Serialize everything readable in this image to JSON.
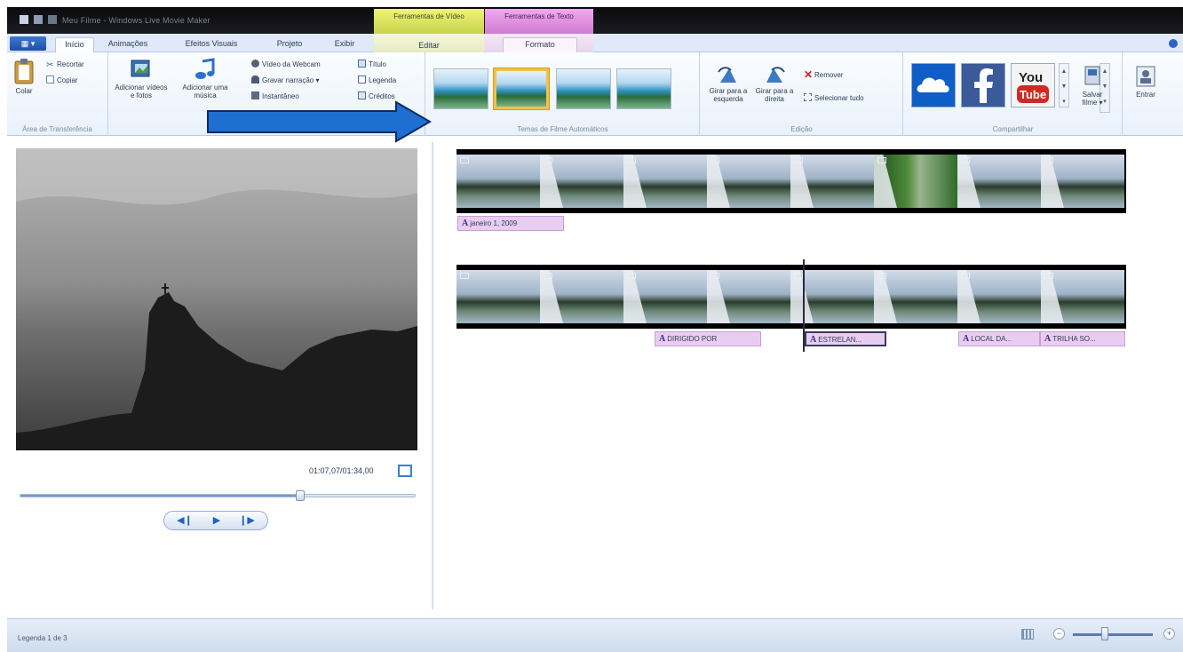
{
  "title_bar": {
    "app_title": "Meu Filme - Windows Live Movie Maker",
    "contextual_groups": [
      {
        "label": "Ferramentas de Vídeo",
        "tab": "Editar",
        "color": "#d9e26a"
      },
      {
        "label": "Ferramentas de Texto",
        "tab": "Formato",
        "color": "#e59be2"
      }
    ]
  },
  "tabs": [
    {
      "label": "Início",
      "active": true
    },
    {
      "label": "Animações"
    },
    {
      "label": "Efeitos Visuais"
    },
    {
      "label": "Projeto"
    },
    {
      "label": "Exibir"
    }
  ],
  "ribbon": {
    "clipboard": {
      "label": "Área de Transferência",
      "paste": "Colar",
      "cut": "Recortar",
      "copy": "Copiar"
    },
    "add": {
      "add_videos": "Adicionar vídeos e fotos",
      "add_music": "Adicionar uma música",
      "webcam": "Vídeo da Webcam",
      "narration": "Gravar narração",
      "snapshot": "Instantâneo",
      "title": "Título",
      "caption": "Legenda",
      "credits": "Créditos"
    },
    "themes": {
      "label": "Temas de Filme Automáticos",
      "selected_index": 1,
      "count": 4
    },
    "editing": {
      "label": "Edição",
      "rotate_left": "Girar para a esquerda",
      "rotate_right": "Girar para a direita",
      "remove": "Remover",
      "select_all": "Selecionar tudo"
    },
    "share": {
      "label": "Compartilhar",
      "services": [
        "OneDrive",
        "Facebook",
        "YouTube"
      ],
      "save_movie": "Salvar filme",
      "sign_in": "Entrar"
    }
  },
  "preview": {
    "timecode": "01:07,07/01:34,00",
    "seek_progress": 0.71
  },
  "storyboard": {
    "row1": {
      "frames": 8,
      "captions": [
        {
          "text": "janeiro 1, 2009"
        }
      ]
    },
    "row2": {
      "frames": 8,
      "captions": [
        {
          "text": "DIRIGIDO POR"
        },
        {
          "text": "ESTRELAN..."
        },
        {
          "text": "LOCAL DA..."
        },
        {
          "text": "TRILHA SO..."
        }
      ]
    }
  },
  "status_bar": {
    "text": "Legenda 1 de 3",
    "zoom_level": 0.4
  },
  "colors": {
    "accent_arrow": "#1e6fd0",
    "caption_bg": "#e9cdf1",
    "selection": "#f0c14a"
  }
}
